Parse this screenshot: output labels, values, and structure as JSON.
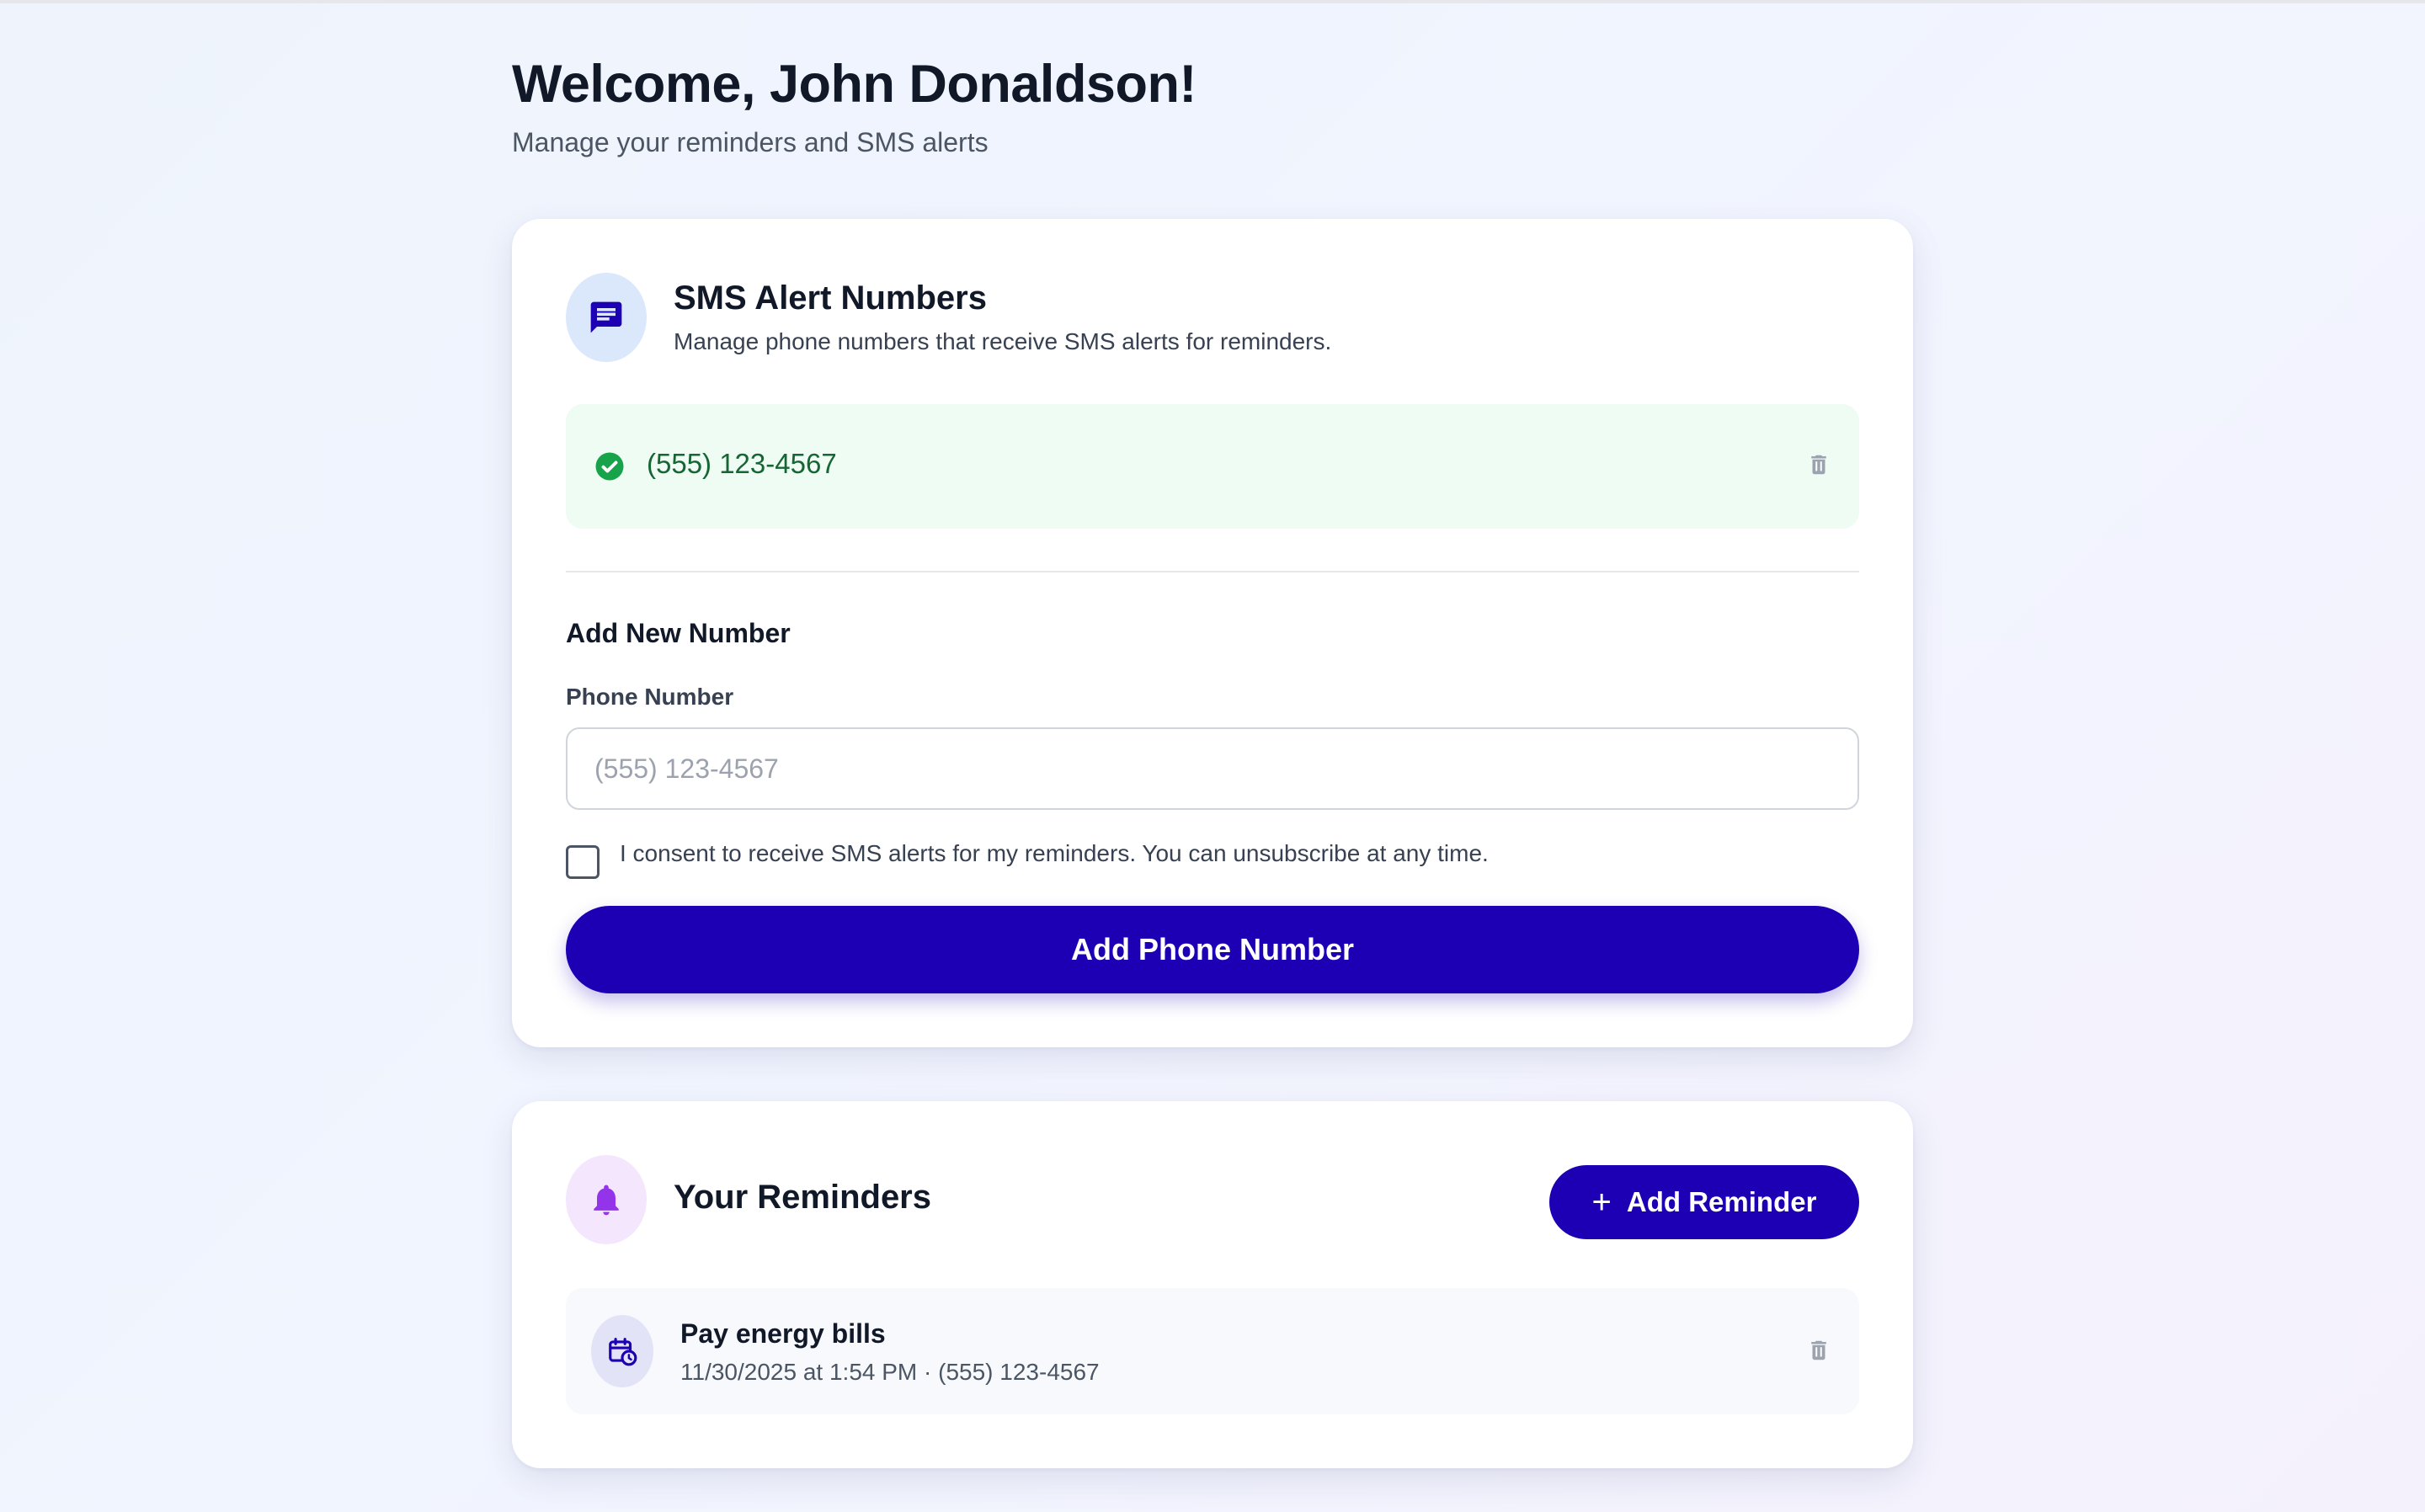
{
  "header": {
    "title": "Welcome, John Donaldson!",
    "subtitle": "Manage your reminders and SMS alerts"
  },
  "sms_card": {
    "icon": "message-icon",
    "title": "SMS Alert Numbers",
    "description": "Manage phone numbers that receive SMS alerts for reminders.",
    "numbers": [
      {
        "phone": "(555) 123-4567",
        "status": "verified",
        "status_color": "#16a34a"
      }
    ],
    "add_section": {
      "title": "Add New Number",
      "field_label": "Phone Number",
      "placeholder": "(555) 123-4567",
      "value": "",
      "consent_text": "I consent to receive SMS alerts for my reminders. You can unsubscribe at any time.",
      "consent_checked": false,
      "submit_label": "Add Phone Number"
    }
  },
  "reminders_card": {
    "icon": "bell-icon",
    "title": "Your Reminders",
    "add_label": "Add Reminder",
    "items": [
      {
        "title": "Pay energy bills",
        "meta": "11/30/2025 at 1:54 PM · (555) 123-4567"
      }
    ]
  },
  "colors": {
    "primary": "#1d00b3",
    "success_bg": "#effcf3",
    "success_text": "#166534",
    "bell_accent": "#9333ea"
  }
}
